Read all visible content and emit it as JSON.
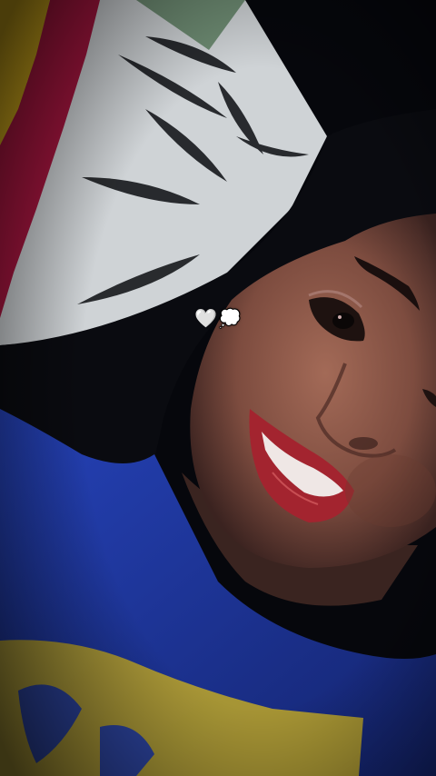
{
  "photo": {
    "palette": {
      "background": "#06070c",
      "pillow_white": "#d9dde0",
      "pillow_red": "#a81640",
      "pillow_yellow": "#d9b21e",
      "pillow_green": "#6e8c73",
      "skin": "#8e5a4b",
      "lips": "#a3242f",
      "shirt_blue": "#1f3aa8",
      "shirt_print_yellow": "#c9b12a",
      "hair": "#0a0b10"
    }
  },
  "overlay": {
    "stickers": [
      {
        "icon": "white-heart-icon",
        "glyph": "🤍"
      },
      {
        "icon": "thought-balloon-icon",
        "glyph": "💭"
      }
    ]
  }
}
